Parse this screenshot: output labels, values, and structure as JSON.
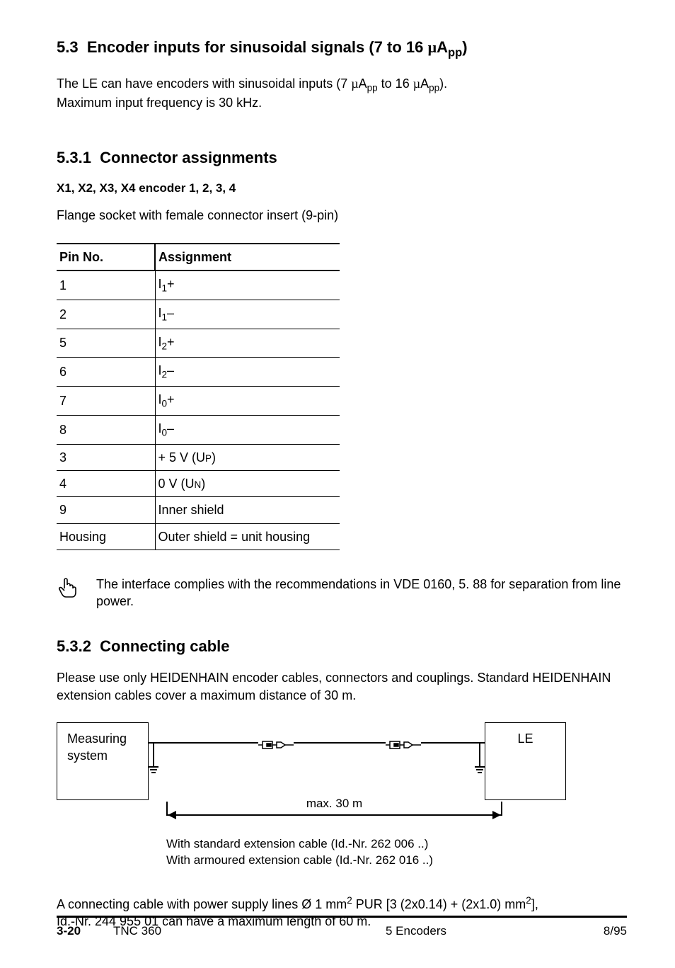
{
  "section53": {
    "number": "5.3",
    "title_before": "Encoder inputs for sinusoidal signals (7 to 16 ",
    "unit_base": "A",
    "unit_sub": "pp",
    "title_close": ")",
    "intro_pre": "The LE can have encoders with sinusoidal inputs (7 ",
    "intro_to": " to 16 ",
    "intro_close": ").",
    "intro_line2": "Maximum input frequency is 30 kHz."
  },
  "section531": {
    "number": "5.3.1",
    "title": "Connector assignments",
    "subheading": "X1, X2, X3, X4 encoder 1, 2, 3, 4",
    "socket_text": "Flange socket with female connector insert (9-pin)"
  },
  "table": {
    "head_pin": "Pin No.",
    "head_assign": "Assignment",
    "rows": [
      {
        "pin": "1",
        "a_base": "I",
        "a_sub": "1",
        "a_suffix": "+"
      },
      {
        "pin": "2",
        "a_base": "I",
        "a_sub": "1",
        "a_suffix": "–"
      },
      {
        "pin": "5",
        "a_base": "I",
        "a_sub": "2",
        "a_suffix": "+"
      },
      {
        "pin": "6",
        "a_base": "I",
        "a_sub": "2",
        "a_suffix": "–"
      },
      {
        "pin": "7",
        "a_base": "I",
        "a_sub": "0",
        "a_suffix": "+"
      },
      {
        "pin": "8",
        "a_base": "I",
        "a_sub": "0",
        "a_suffix": "–"
      },
      {
        "pin": "3",
        "a_plain_pre": "+ 5 V (U",
        "a_plain_sub": "P",
        "a_plain_post": ")"
      },
      {
        "pin": "4",
        "a_plain_pre": "0 V (U",
        "a_plain_sub": "N",
        "a_plain_post": ")"
      },
      {
        "pin": "9",
        "a_text": "Inner shield"
      },
      {
        "pin": "Housing",
        "a_text": "Outer shield = unit housing"
      }
    ]
  },
  "note": {
    "text": "The interface complies with the recommendations in VDE 0160, 5. 88 for separation from line power."
  },
  "section532": {
    "number": "5.3.2",
    "title": "Connecting cable",
    "para": "Please use only HEIDENHAIN encoder cables, connectors and couplings. Standard HEIDENHAIN extension cables cover a maximum distance of 30 m."
  },
  "diagram": {
    "box_left": "Measuring system",
    "box_right": "LE",
    "dim_label": "max. 30 m",
    "caption1": "With standard extension cable (Id.-Nr. 262 006 ..)",
    "caption2": "With armoured extension cable (Id.-Nr. 262 016 ..)"
  },
  "closing": {
    "pre": "A connecting cable with power supply lines Ø 1 mm",
    "sup1": "2",
    "mid": " PUR [3 (2x0.14) + (2x1.0) mm",
    "sup2": "2",
    "post": "],",
    "line2": "Id.-Nr. 244 955 01 can have a maximum length of 60 m."
  },
  "footer": {
    "page": "3-20",
    "model": "TNC 360",
    "chapter": "5  Encoders",
    "date": "8/95"
  }
}
